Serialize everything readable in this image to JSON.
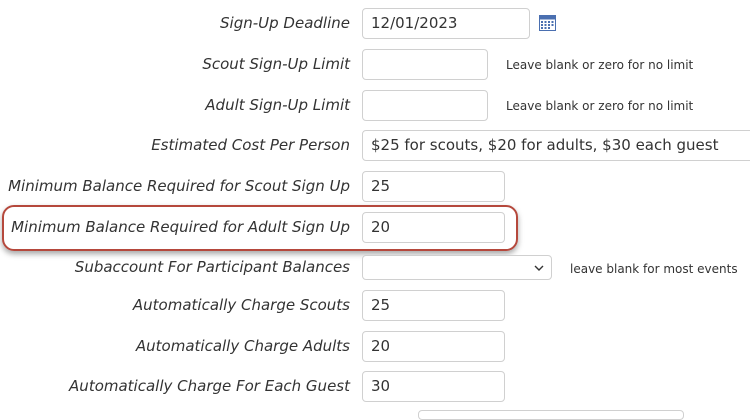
{
  "form": {
    "fields": [
      {
        "label": "Sign-Up Deadline",
        "value": "12/01/2023",
        "hint": ""
      },
      {
        "label": "Scout Sign-Up Limit",
        "value": "",
        "hint": "Leave blank or zero for no limit"
      },
      {
        "label": "Adult Sign-Up Limit",
        "value": "",
        "hint": "Leave blank or zero for no limit"
      },
      {
        "label": "Estimated Cost Per Person",
        "value": "$25 for scouts, $20 for adults, $30 each guest",
        "hint": ""
      },
      {
        "label": "Minimum Balance Required for Scout Sign Up",
        "value": "25",
        "hint": ""
      },
      {
        "label": "Minimum Balance Required for Adult Sign Up",
        "value": "20",
        "hint": ""
      },
      {
        "label": "Subaccount For Participant Balances",
        "value": "",
        "hint": "leave blank for most events"
      },
      {
        "label": "Automatically Charge Scouts",
        "value": "25",
        "hint": ""
      },
      {
        "label": "Automatically Charge Adults",
        "value": "20",
        "hint": ""
      },
      {
        "label": "Automatically Charge For Each Guest",
        "value": "30",
        "hint": ""
      }
    ]
  },
  "colors": {
    "highlight_border": "#b5483c",
    "field_border": "#d0d0d0",
    "text": "#333333"
  },
  "icons": {
    "calendar": "calendar-icon",
    "dropdown": "chevron-down-icon"
  }
}
